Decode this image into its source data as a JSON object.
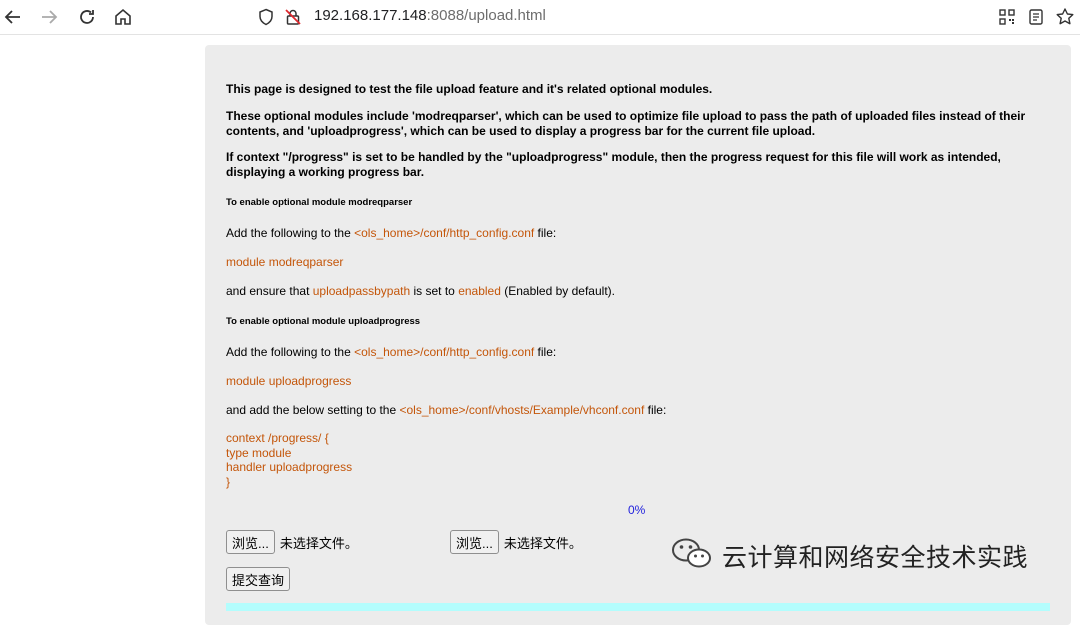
{
  "browser": {
    "url_host": "192.168.177.148",
    "url_rest": ":8088/upload.html",
    "icons": [
      "back-icon",
      "forward-icon",
      "reload-icon",
      "home-icon",
      "shield-icon",
      "insecure-lock-icon",
      "qr-code-icon",
      "reader-mode-icon",
      "bookmark-star-icon"
    ]
  },
  "page": {
    "intro1": "This page is designed to test the file upload feature and it's related optional modules.",
    "intro2": "These optional modules include 'modreqparser', which can be used to optimize file upload to pass the path of uploaded files instead of their contents, and 'uploadprogress', which can be used to display a progress bar for the current file upload.",
    "intro3": "If context \"/progress\" is set to be handled by the \"uploadprogress\" module, then the progress request for this file will work as intended, displaying a working progress bar.",
    "heading1": "To enable optional module modreqparser",
    "add_prefix": "Add the following to the ",
    "http_config_path": "<ols_home>/conf/http_config.conf",
    "file_suffix": " file:",
    "module1": "module modreqparser",
    "ensure_prefix": "and ensure that ",
    "uploadpassbypath": "uploadpassbypath",
    "ensure_mid": " is set to ",
    "enabled": "enabled",
    "ensure_suffix": " (Enabled by default).",
    "heading2": "To enable optional module uploadprogress",
    "module2": "module uploadprogress",
    "vhost_prefix": "and add the below setting to the ",
    "vhconf_path": "<ols_home>/conf/vhosts/Example/vhconf.conf",
    "code_lines": [
      "context /progress/ {",
      "type module",
      "handler uploadprogress",
      "}"
    ],
    "progress": "0%",
    "browse_label": "浏览...",
    "no_file_label": "未选择文件。",
    "submit_label": "提交查询"
  },
  "watermark": {
    "text": "云计算和网络安全技术实践"
  },
  "colors": {
    "highlight": "#c4560a",
    "progress_text": "#2222dd",
    "panel_bg": "#ececec",
    "bottom_bar": "#b3fdfd"
  }
}
